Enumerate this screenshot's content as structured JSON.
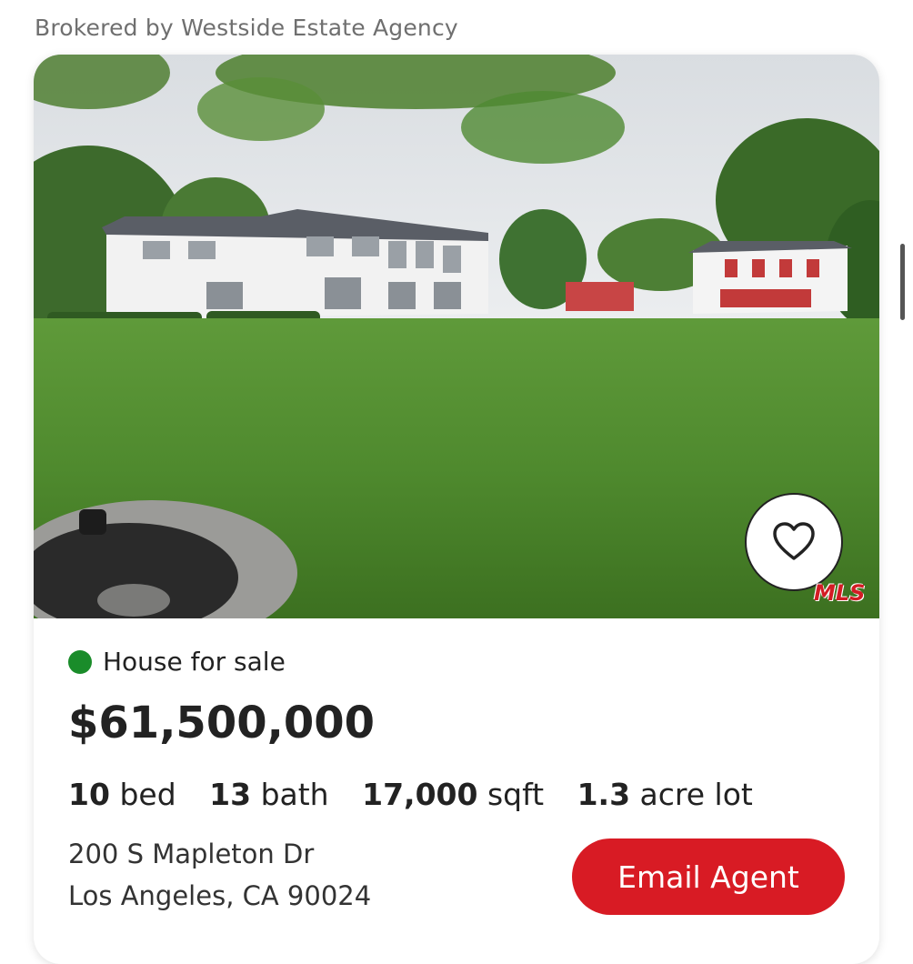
{
  "broker": {
    "text": "Brokered by Westside Estate Agency"
  },
  "listing": {
    "photo_icon": "house-photo",
    "favorite_icon": "heart-icon",
    "mls_logo_text": "MLS",
    "status": {
      "dot_color": "#1a8c2a",
      "label": "House for sale"
    },
    "price": "$61,500,000",
    "specs": [
      {
        "value": "10",
        "unit": "bed"
      },
      {
        "value": "13",
        "unit": "bath"
      },
      {
        "value": "17,000",
        "unit": "sqft"
      },
      {
        "value": "1.3",
        "unit": "acre lot"
      }
    ],
    "address": {
      "line1": "200 S Mapleton Dr",
      "line2": "Los Angeles, CA 90024"
    },
    "email_button_label": "Email Agent",
    "accent_color": "#d81b24"
  }
}
